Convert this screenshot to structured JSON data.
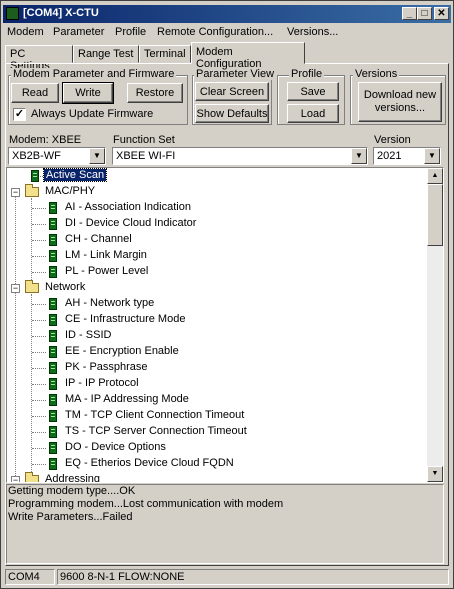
{
  "window": {
    "title": "[COM4] X-CTU"
  },
  "titlebar_buttons": {
    "minimize": "_",
    "maximize": "□",
    "close": "✕"
  },
  "menu": [
    "Modem",
    "Parameter",
    "Profile",
    "Remote Configuration...",
    "Versions..."
  ],
  "tabs": [
    {
      "label": "PC Settings",
      "active": false
    },
    {
      "label": "Range Test",
      "active": false
    },
    {
      "label": "Terminal",
      "active": false
    },
    {
      "label": "Modem Configuration",
      "active": true
    }
  ],
  "groups": {
    "firmware": {
      "label": "Modem Parameter and Firmware",
      "read": "Read",
      "write": "Write",
      "restore": "Restore",
      "always_update": "Always Update Firmware",
      "always_update_checked": true
    },
    "view": {
      "label": "Parameter View",
      "clear": "Clear Screen",
      "defaults": "Show Defaults"
    },
    "profile": {
      "label": "Profile",
      "save": "Save",
      "load": "Load"
    },
    "versions": {
      "label": "Versions",
      "download_line1": "Download new",
      "download_line2": "versions..."
    }
  },
  "selectors": {
    "modem": {
      "label": "Modem: XBEE",
      "value": "XB2B-WF"
    },
    "function_set": {
      "label": "Function Set",
      "value": "XBEE WI-FI"
    },
    "version": {
      "label": "Version",
      "value": "2021"
    }
  },
  "tree": {
    "active_scan": "Active Scan",
    "sections": [
      {
        "name": "MAC/PHY",
        "items": [
          "AI - Association Indication",
          "DI - Device Cloud Indicator",
          "CH - Channel",
          "LM - Link Margin",
          "PL - Power Level"
        ]
      },
      {
        "name": "Network",
        "items": [
          "AH - Network type",
          "CE - Infrastructure Mode",
          "ID - SSID",
          "EE - Encryption Enable",
          "PK - Passphrase",
          "IP - IP Protocol",
          "MA - IP Addressing Mode",
          "TM - TCP Client Connection Timeout",
          "TS - TCP Server Connection Timeout",
          "DO - Device Options",
          "EQ - Etherios Device Cloud FQDN"
        ]
      },
      {
        "name": "Addressing",
        "items": []
      }
    ],
    "expander_minus": "−"
  },
  "log": [
    "Getting modem type....OK",
    "Programming modem...Lost communication with modem",
    "Write Parameters...Failed"
  ],
  "status": {
    "port": "COM4",
    "settings": "9600 8-N-1  FLOW:NONE"
  },
  "scroll": {
    "up": "▲",
    "down": "▼"
  },
  "combo_arrow": "▼",
  "checkmark": "✓"
}
